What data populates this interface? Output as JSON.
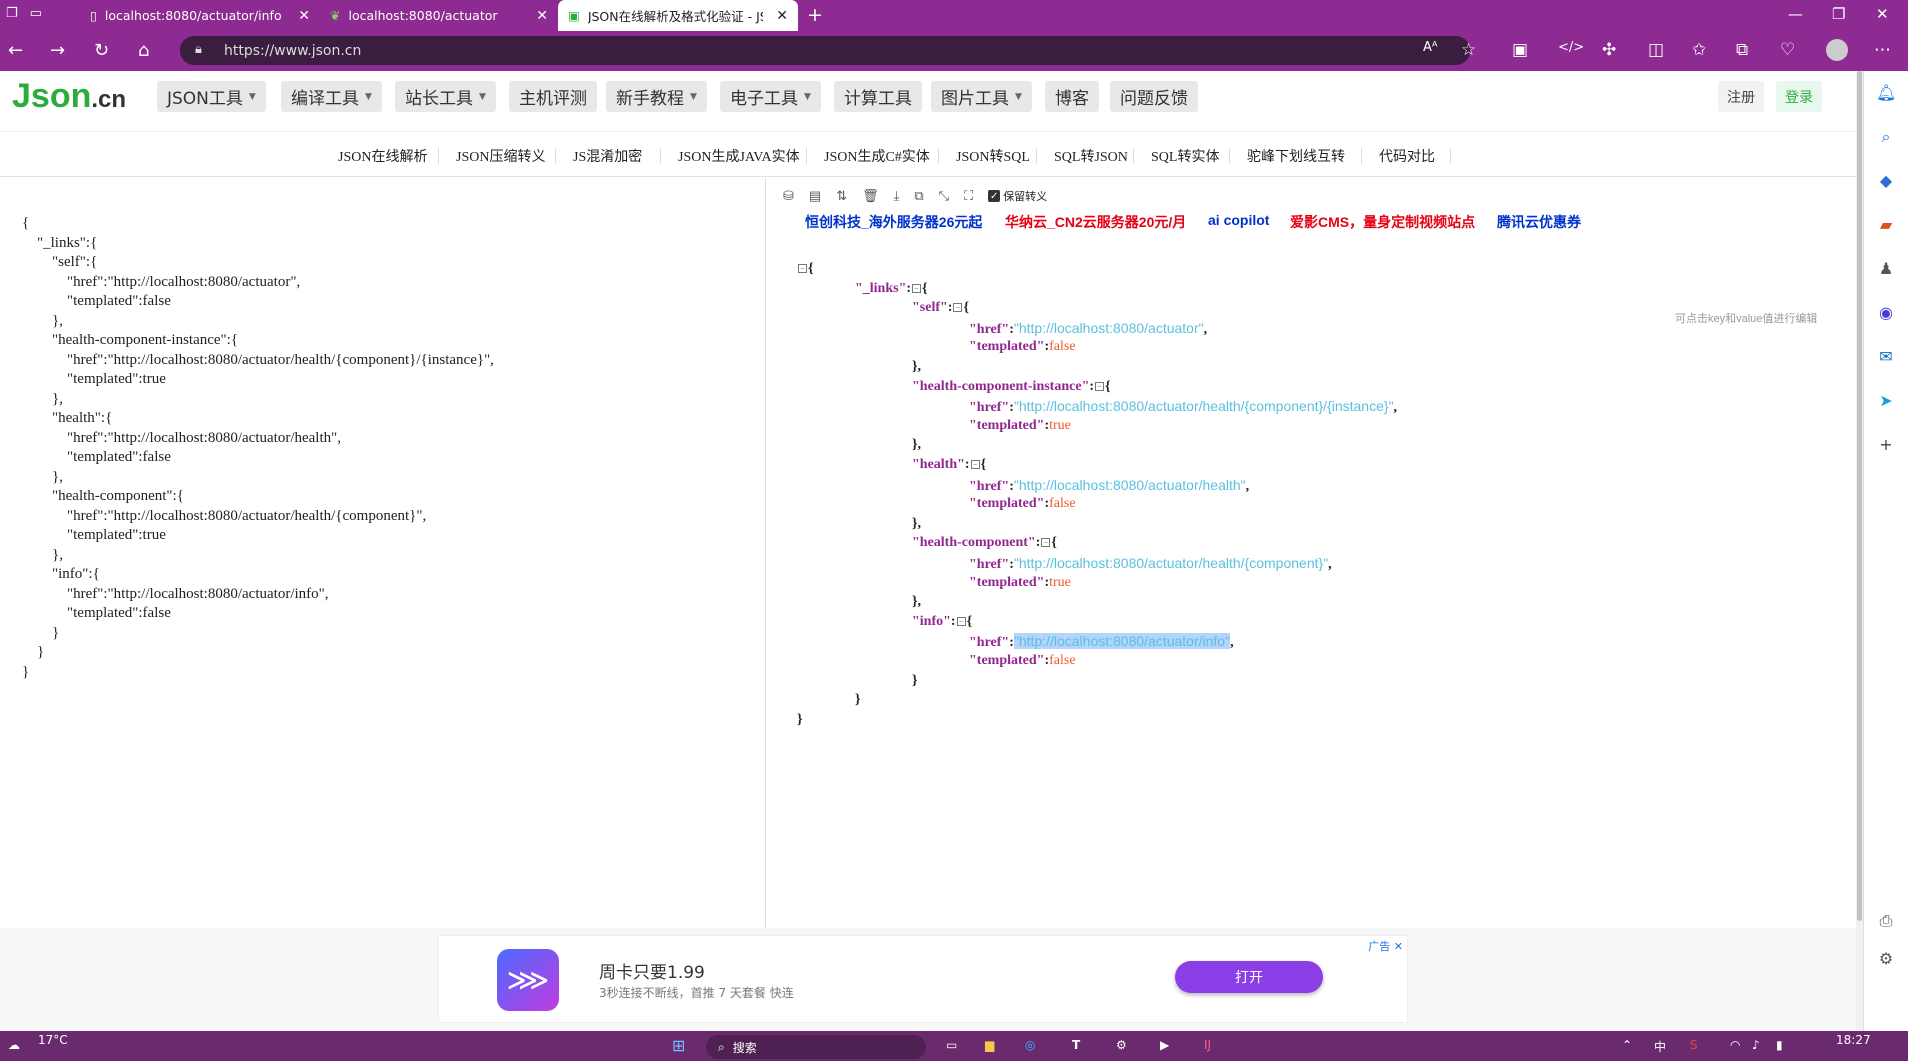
{
  "browser": {
    "tabs": [
      {
        "title": "localhost:8080/actuator/info"
      },
      {
        "title": "localhost:8080/actuator"
      },
      {
        "title": "JSON在线解析及格式化验证 - JS"
      }
    ],
    "new_tab": "+",
    "url": "https://www.json.cn"
  },
  "site": {
    "logo_main": "Json",
    "logo_suffix": ".cn",
    "menus": [
      {
        "label": "JSON工具",
        "dropdown": true
      },
      {
        "label": "编译工具",
        "dropdown": true
      },
      {
        "label": "站长工具",
        "dropdown": true
      },
      {
        "label": "主机评测",
        "dropdown": false
      },
      {
        "label": "新手教程",
        "dropdown": true
      },
      {
        "label": "电子工具",
        "dropdown": true
      },
      {
        "label": "计算工具",
        "dropdown": false
      },
      {
        "label": "图片工具",
        "dropdown": true
      },
      {
        "label": "博客",
        "dropdown": false
      },
      {
        "label": "问题反馈",
        "dropdown": false
      }
    ],
    "register": "注册",
    "login": "登录",
    "subnav": [
      "JSON在线解析",
      "JSON压缩转义",
      "JS混淆加密",
      "JSON生成JAVA实体",
      "JSON生成C#实体",
      "JSON转SQL",
      "SQL转JSON",
      "SQL转实体",
      "驼峰下划线互转",
      "代码对比"
    ]
  },
  "editor": {
    "lines": [
      "{",
      "    \"_links\":{",
      "        \"self\":{",
      "            \"href\":\"http://localhost:8080/actuator\",",
      "            \"templated\":false",
      "        },",
      "        \"health-component-instance\":{",
      "            \"href\":\"http://localhost:8080/actuator/health/{component}/{instance}\",",
      "            \"templated\":true",
      "        },",
      "        \"health\":{",
      "            \"href\":\"http://localhost:8080/actuator/health\",",
      "            \"templated\":false",
      "        },",
      "        \"health-component\":{",
      "            \"href\":\"http://localhost:8080/actuator/health/{component}\",",
      "            \"templated\":true",
      "        },",
      "        \"info\":{",
      "            \"href\":\"http://localhost:8080/actuator/info\",",
      "            \"templated\":false",
      "        }",
      "    }",
      "}"
    ]
  },
  "viewer": {
    "keep_escape_label": "保留转义",
    "ads": [
      {
        "text": "恒创科技_海外服务器26元起",
        "color": "#0033cc"
      },
      {
        "text": "华纳云_CN2云服务器20元/月",
        "color": "#e60012"
      },
      {
        "text": "ai copilot",
        "color": "#0033cc"
      },
      {
        "text": "爱影CMS，量身定制视频站点",
        "color": "#e60012"
      },
      {
        "text": "腾讯云优惠券",
        "color": "#0033cc"
      }
    ],
    "hint": "可点击key和value值进行编辑",
    "root_key": "_links",
    "entries": [
      {
        "key": "self",
        "href": "http://localhost:8080/actuator",
        "templated": "false"
      },
      {
        "key": "health-component-instance",
        "href": "http://localhost:8080/actuator/health/{component}/{instance}",
        "templated": "true"
      },
      {
        "key": "health",
        "href": "http://localhost:8080/actuator/health",
        "templated": "false"
      },
      {
        "key": "health-component",
        "href": "http://localhost:8080/actuator/health/{component}",
        "templated": "true"
      },
      {
        "key": "info",
        "href": "http://localhost:8080/actuator/info",
        "templated": "false"
      }
    ],
    "href_key": "href",
    "templated_key": "templated"
  },
  "ad_banner": {
    "title": "周卡只要1.99",
    "subtitle": "3秒连接不断线，首推 7 天套餐 快连",
    "button": "打开",
    "mark": "广告"
  },
  "taskbar": {
    "weather": "17°C",
    "search": "搜索",
    "ime": "中",
    "time": "18:27"
  }
}
